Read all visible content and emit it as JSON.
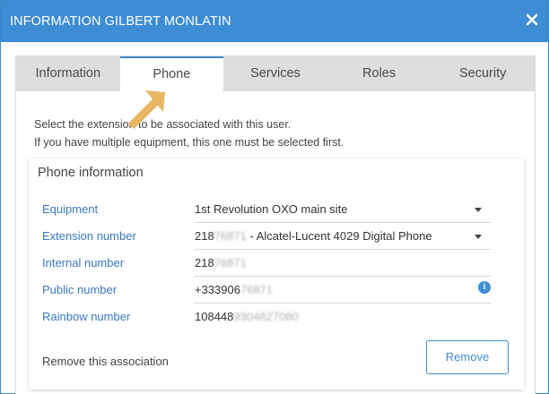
{
  "dialog": {
    "title": "INFORMATION GILBERT MONLATIN",
    "close_icon": "close-icon"
  },
  "tabs": [
    {
      "label": "Information",
      "active": false
    },
    {
      "label": "Phone",
      "active": true
    },
    {
      "label": "Services",
      "active": false
    },
    {
      "label": "Roles",
      "active": false
    },
    {
      "label": "Security",
      "active": false
    }
  ],
  "hint": {
    "line1": "Select the extension to be associated with this user.",
    "line2": "If you have multiple equipment, this one must be selected first."
  },
  "phone_info": {
    "title": "Phone information",
    "equipment": {
      "label": "Equipment",
      "value": "1st Revolution OXO main site"
    },
    "extension": {
      "label": "Extension number",
      "value_prefix": "218",
      "value_blur": "76871",
      "value_suffix": " - Alcatel-Lucent 4029 Digital Phone"
    },
    "internal": {
      "label": "Internal number",
      "value_prefix": "218",
      "value_blur": "76871"
    },
    "public": {
      "label": "Public number",
      "value_prefix": "+333906",
      "value_blur": "76871"
    },
    "rainbow": {
      "label": "Rainbow number",
      "value_prefix": "108448",
      "value_blur": "9304827080"
    }
  },
  "remove": {
    "text": "Remove this association",
    "button_label": "Remove"
  },
  "colors": {
    "accent": "#3d8cd4",
    "arrow": "#e8b765",
    "tab_bar": "#dedede"
  }
}
